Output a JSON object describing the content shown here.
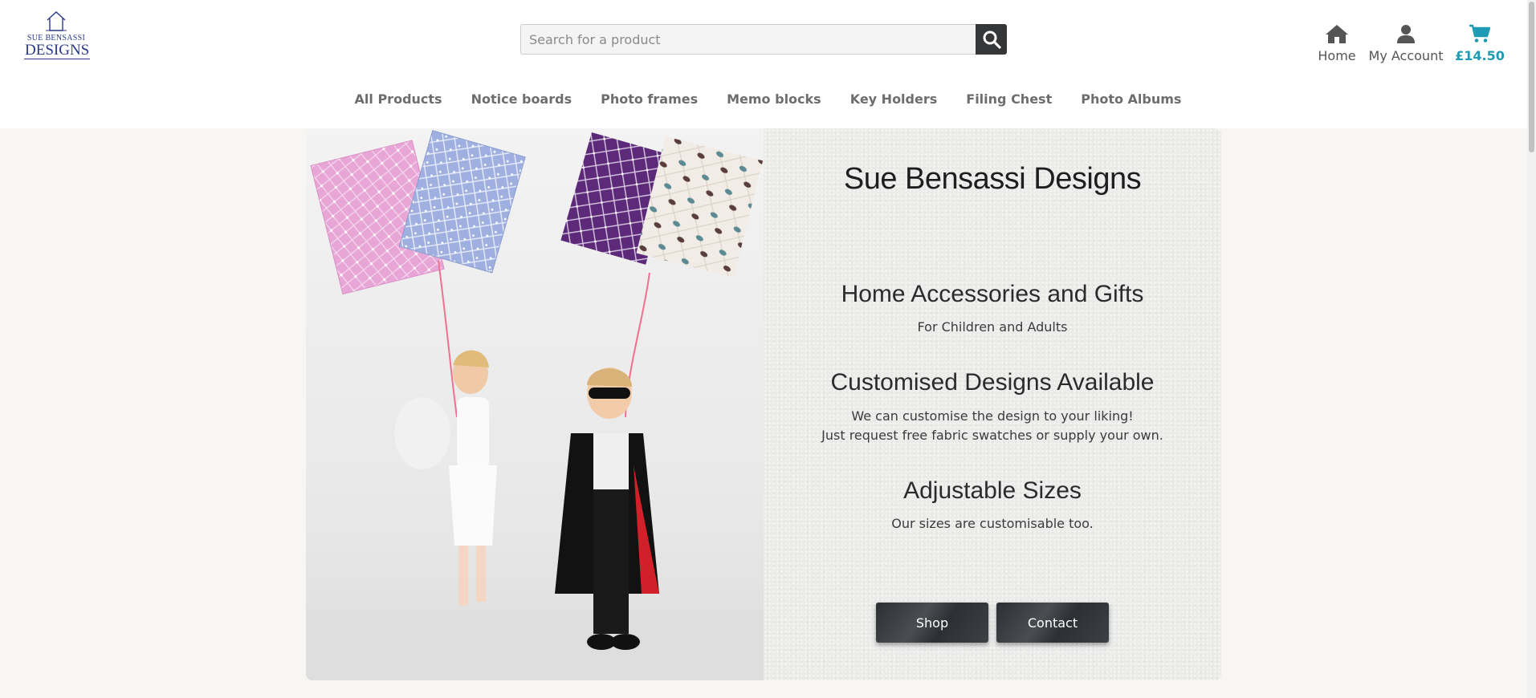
{
  "brand": {
    "logo_line1": "SUE BENSASSI",
    "logo_line2": "DESIGNS"
  },
  "search": {
    "placeholder": "Search for a product",
    "value": ""
  },
  "top_nav": {
    "home": "Home",
    "account": "My Account",
    "cart_total": "£14.50"
  },
  "categories": [
    "All Products",
    "Notice boards",
    "Photo frames",
    "Memo blocks",
    "Key Holders",
    "Filing Chest",
    "Photo Albums"
  ],
  "hero": {
    "title": "Sue Bensassi Designs",
    "section1_heading": "Home Accessories and Gifts",
    "section1_text": "For Children and Adults",
    "section2_heading": "Customised Designs Available",
    "section2_line1": "We can customise the design to your liking!",
    "section2_line2": "Just request free fabric swatches or supply your own.",
    "section3_heading": "Adjustable Sizes",
    "section3_text": "Our sizes are customisable too.",
    "shop_label": "Shop",
    "contact_label": "Contact"
  },
  "colors": {
    "accent": "#1f9bb6",
    "logo": "#2a3a8a",
    "nav_text": "#6d6d6d",
    "button_dark": "#343638"
  },
  "icons": {
    "search": "magnifier-icon",
    "home": "home-icon",
    "account": "user-icon",
    "cart": "cart-icon"
  }
}
